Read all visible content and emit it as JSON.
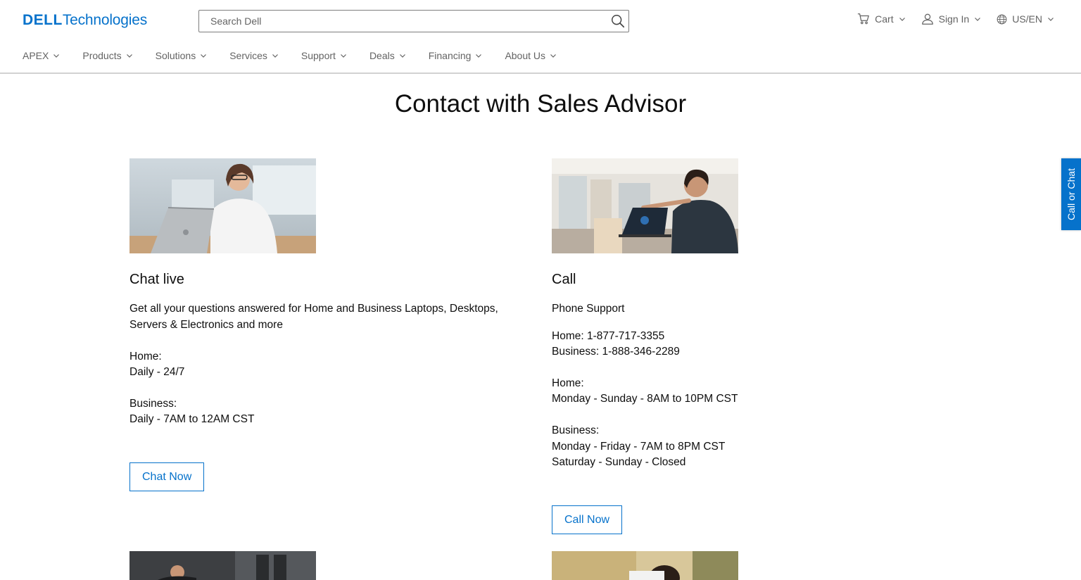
{
  "header": {
    "logo": {
      "brand": "DELL",
      "suffix": "Technologies"
    },
    "search": {
      "placeholder": "Search Dell"
    },
    "utilities": {
      "cart": "Cart",
      "sign_in": "Sign In",
      "locale": "US/EN"
    }
  },
  "nav": {
    "items": [
      {
        "label": "APEX"
      },
      {
        "label": "Products"
      },
      {
        "label": "Solutions"
      },
      {
        "label": "Services"
      },
      {
        "label": "Support"
      },
      {
        "label": "Deals"
      },
      {
        "label": "Financing"
      },
      {
        "label": "About Us"
      }
    ]
  },
  "main": {
    "title": "Contact with Sales Advisor",
    "chat": {
      "title": "Chat live",
      "description": "Get all your questions answered for Home and Business Laptops, Desktops, Servers & Electronics and more",
      "home_label": "Home:",
      "home_hours": "Daily - 24/7",
      "business_label": "Business:",
      "business_hours": "Daily - 7AM to 12AM  CST",
      "button": "Chat Now"
    },
    "call": {
      "title": "Call",
      "subtitle": "Phone Support",
      "home_phone": "Home: 1-877-717-3355",
      "business_phone": "Business: 1-888-346-2289",
      "home_label": "Home:",
      "home_hours": "Monday - Sunday - 8AM to 10PM CST",
      "business_label": "Business:",
      "business_hours_weekday": "Monday - Friday - 7AM to 8PM CST",
      "business_hours_weekend": "Saturday - Sunday - Closed",
      "button": "Call Now"
    }
  },
  "side_tab": {
    "label": "Call or Chat"
  },
  "colors": {
    "accent": "#0672cb",
    "text": "#0e0e0e",
    "muted": "#636363"
  }
}
